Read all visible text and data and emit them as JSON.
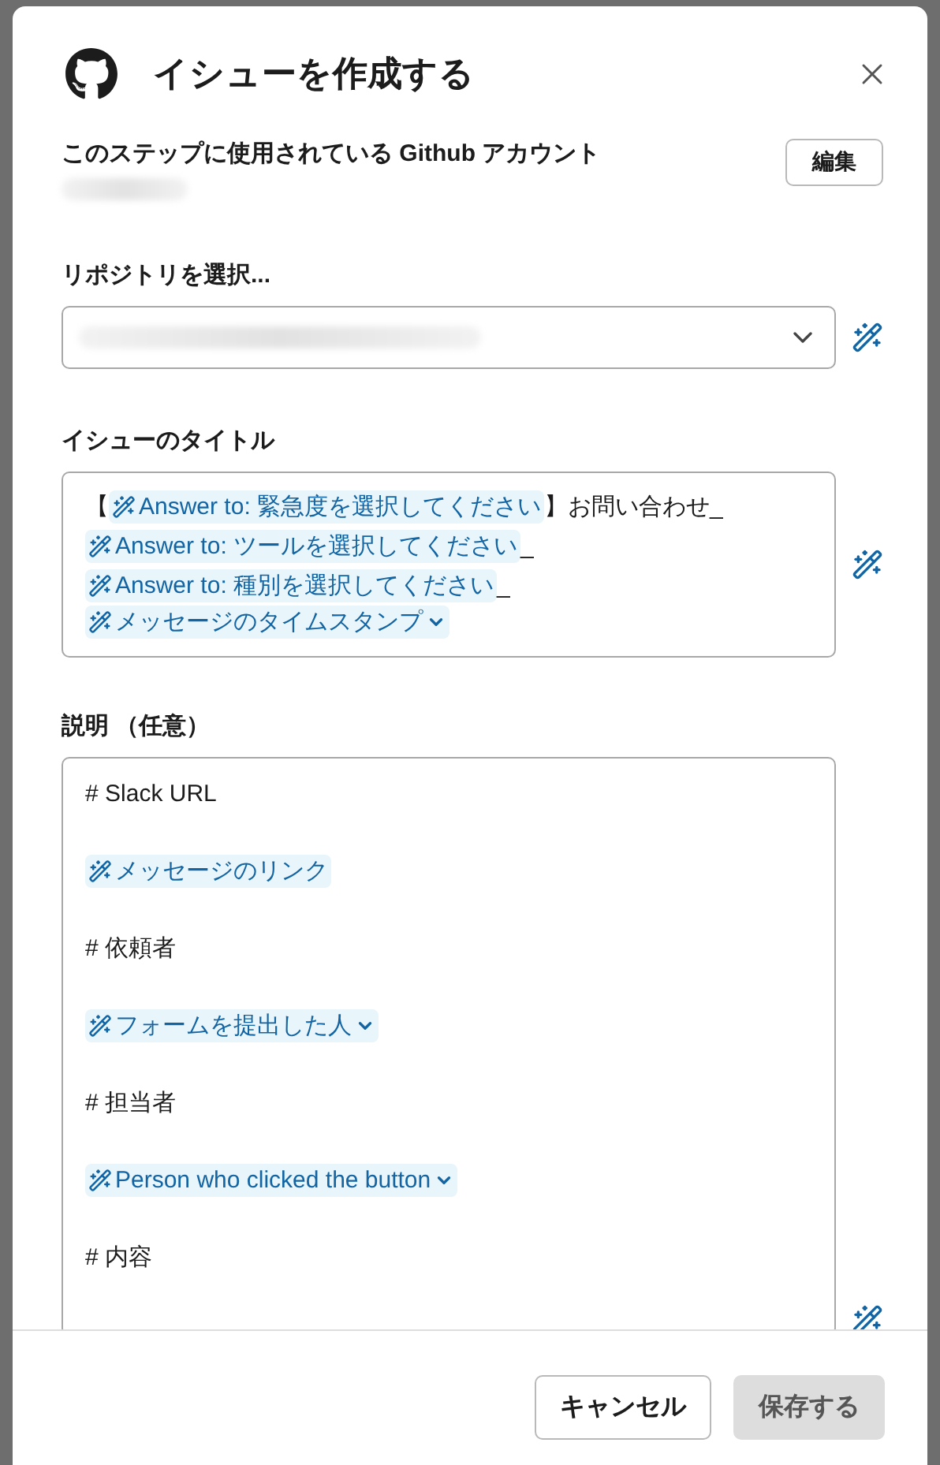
{
  "dialog": {
    "title": "イシューを作成する"
  },
  "account": {
    "label": "このステップに使用されている Github アカウント",
    "edit_button": "編集"
  },
  "repository": {
    "label": "リポジトリを選択..."
  },
  "issue_title": {
    "label": "イシューのタイトル",
    "lines": [
      [
        {
          "kind": "text",
          "text": "【"
        },
        {
          "kind": "token",
          "text": "Answer to: 緊急度を選択してください",
          "dropdown": false
        },
        {
          "kind": "text",
          "text": "】お問い合わせ_"
        }
      ],
      [
        {
          "kind": "token",
          "text": "Answer to: ツールを選択してください",
          "dropdown": false
        },
        {
          "kind": "text",
          "text": "_"
        }
      ],
      [
        {
          "kind": "token",
          "text": "Answer to: 種別を選択してください",
          "dropdown": false
        },
        {
          "kind": "text",
          "text": "_"
        }
      ],
      [
        {
          "kind": "token",
          "text": "メッセージのタイムスタンプ",
          "dropdown": true
        }
      ]
    ]
  },
  "description": {
    "label": "説明 （任意）",
    "paragraphs": [
      [
        {
          "kind": "text",
          "text": "# Slack URL"
        }
      ],
      [
        {
          "kind": "token",
          "text": "メッセージのリンク",
          "dropdown": false
        }
      ],
      [
        {
          "kind": "text",
          "text": "# 依頼者"
        }
      ],
      [
        {
          "kind": "token",
          "text": "フォームを提出した人",
          "dropdown": true
        }
      ],
      [
        {
          "kind": "text",
          "text": "# 担当者"
        }
      ],
      [
        {
          "kind": "token",
          "text": "Person who clicked the button",
          "dropdown": true
        }
      ],
      [
        {
          "kind": "text",
          "text": "# 内容"
        }
      ]
    ]
  },
  "buttons": [
    {
      "label": "キャンセル",
      "disabled": false
    },
    {
      "label": "保存する",
      "disabled": true
    }
  ]
}
